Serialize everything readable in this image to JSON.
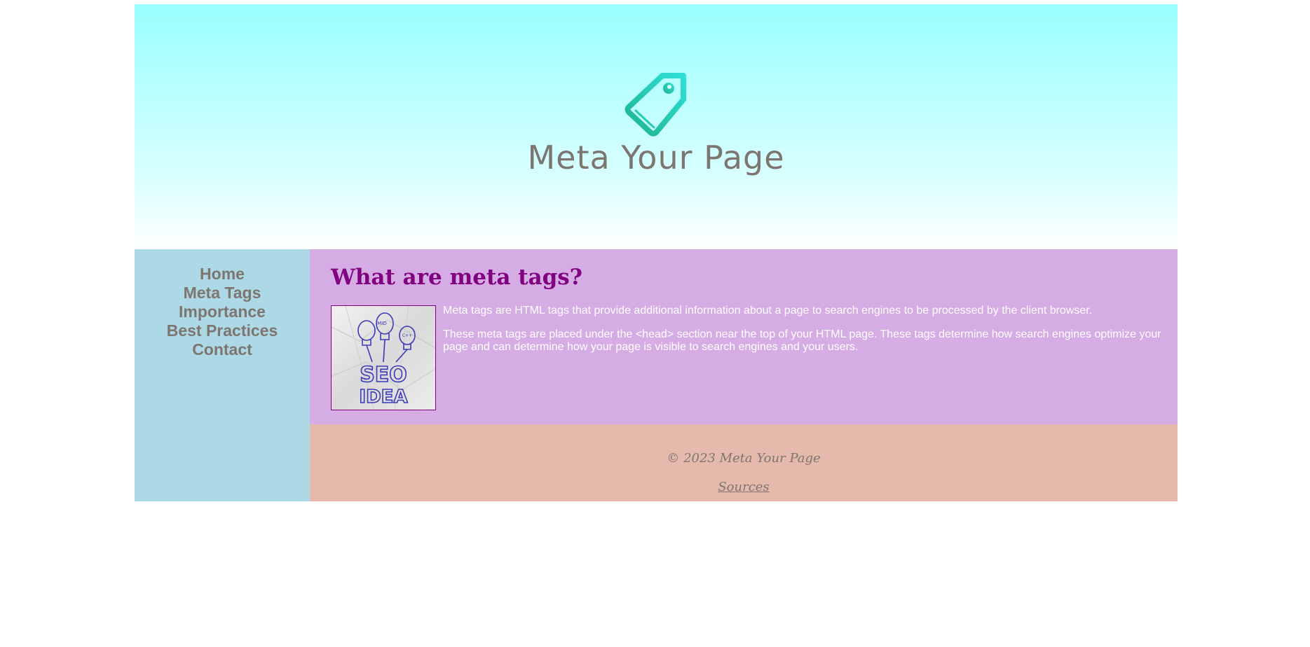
{
  "header": {
    "logo_text": "Meta Your Page",
    "logo_icon": "tag-icon"
  },
  "nav": {
    "items": [
      {
        "label": "Home"
      },
      {
        "label": "Meta Tags"
      },
      {
        "label": "Importance"
      },
      {
        "label": "Best Practices"
      },
      {
        "label": "Contact"
      }
    ]
  },
  "main": {
    "heading": "What are meta tags?",
    "image": {
      "lettering": [
        "SEO",
        "IDEA",
        "MID",
        "C++"
      ]
    },
    "paragraphs": [
      "Meta tags are HTML tags that provide additional information about a page to search engines to be processed by the client browser.",
      "These meta tags are placed under the <head> section near the top of your HTML page. These tags determine how search engines optimize your page and can determine how your page is visible to search engines and your users."
    ]
  },
  "footer": {
    "copyright": "© 2023 Meta Your Page",
    "sources_label": "Sources"
  },
  "colors": {
    "header_top": "#99ffff",
    "sidebar": "#add8e6",
    "content": "#d6ace4",
    "footer": "#e6b9ad",
    "heading": "#800080",
    "text_gray": "#7d7670",
    "logo_teal_start": "#1fb38f",
    "logo_teal_end": "#2ee0d6"
  }
}
